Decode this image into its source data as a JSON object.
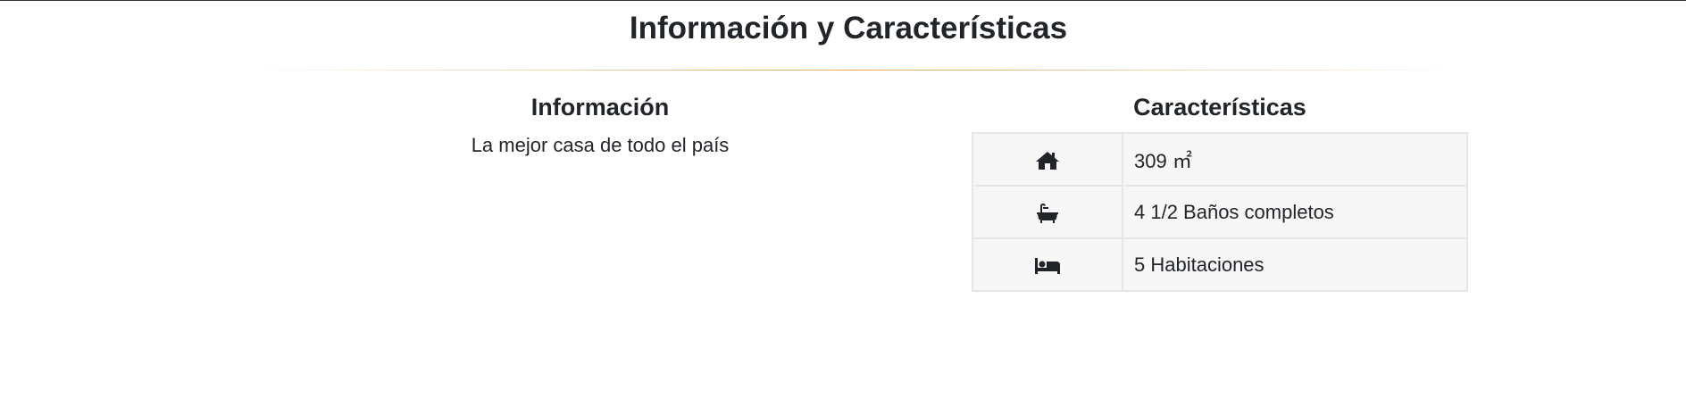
{
  "section": {
    "title": "Información y Características"
  },
  "info": {
    "heading": "Información",
    "text": "La mejor casa de todo el país"
  },
  "features": {
    "heading": "Características",
    "rows": [
      {
        "icon": "home-icon",
        "value": "309 ㎡"
      },
      {
        "icon": "bathtub-icon",
        "value": "4 1/2 Baños completos"
      },
      {
        "icon": "bed-icon",
        "value": "5 Habitaciones"
      }
    ]
  }
}
